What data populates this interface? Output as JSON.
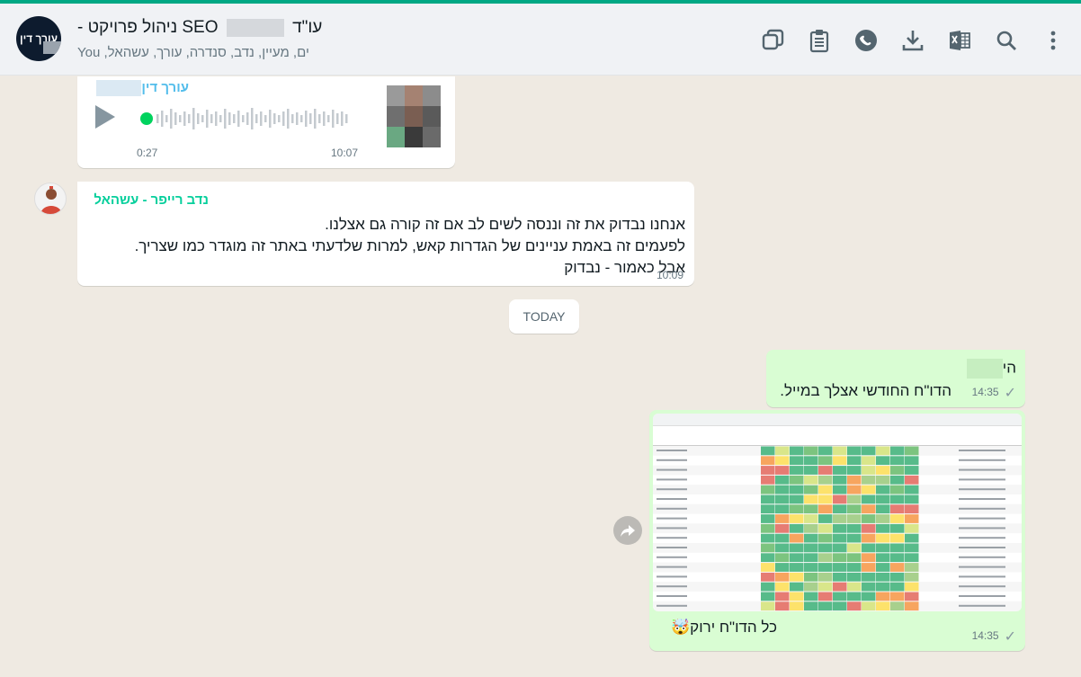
{
  "header": {
    "avatar_label": "עורך דין",
    "title_prefix": "עו\"ד",
    "title_suffix": "- ניהול פרויקט SEO",
    "subtitle": "You ,ים, מעיין, נדב, סנדרה, עורך, עשהאל",
    "icons": [
      "new-chat-icon",
      "clipboard-icon",
      "whatsapp-icon",
      "download-icon",
      "excel-icon",
      "search-icon",
      "menu-icon"
    ]
  },
  "voice_message": {
    "sender": "עורך דין",
    "duration": "0:27",
    "time": "10:07"
  },
  "message2": {
    "sender": "נדב רייפר - עשהאל",
    "lines": [
      "אנחנו נבדוק את זה וננסה לשים לב אם זה קורה גם אצלנו.",
      "לפעמים זה באמת עניינים של הגדרות קאש, למרות שלדעתי באתר זה מוגדר כמו שצריך.",
      "אבל כאמור - נבדוק"
    ],
    "time": "10:09"
  },
  "date_divider": "TODAY",
  "message3": {
    "greeting": "הי",
    "text": "הדו\"ח החודשי אצלך במייל.",
    "time": "14:35"
  },
  "message4": {
    "caption": "כל הדו\"ח ירוק🤯",
    "time": "14:35"
  },
  "colors": {
    "accent": "#00a884",
    "outgoing_bubble": "#d9fdd3",
    "incoming_bubble": "#ffffff",
    "sender_blue": "#53bdeb",
    "sender_green": "#06cf9c"
  }
}
